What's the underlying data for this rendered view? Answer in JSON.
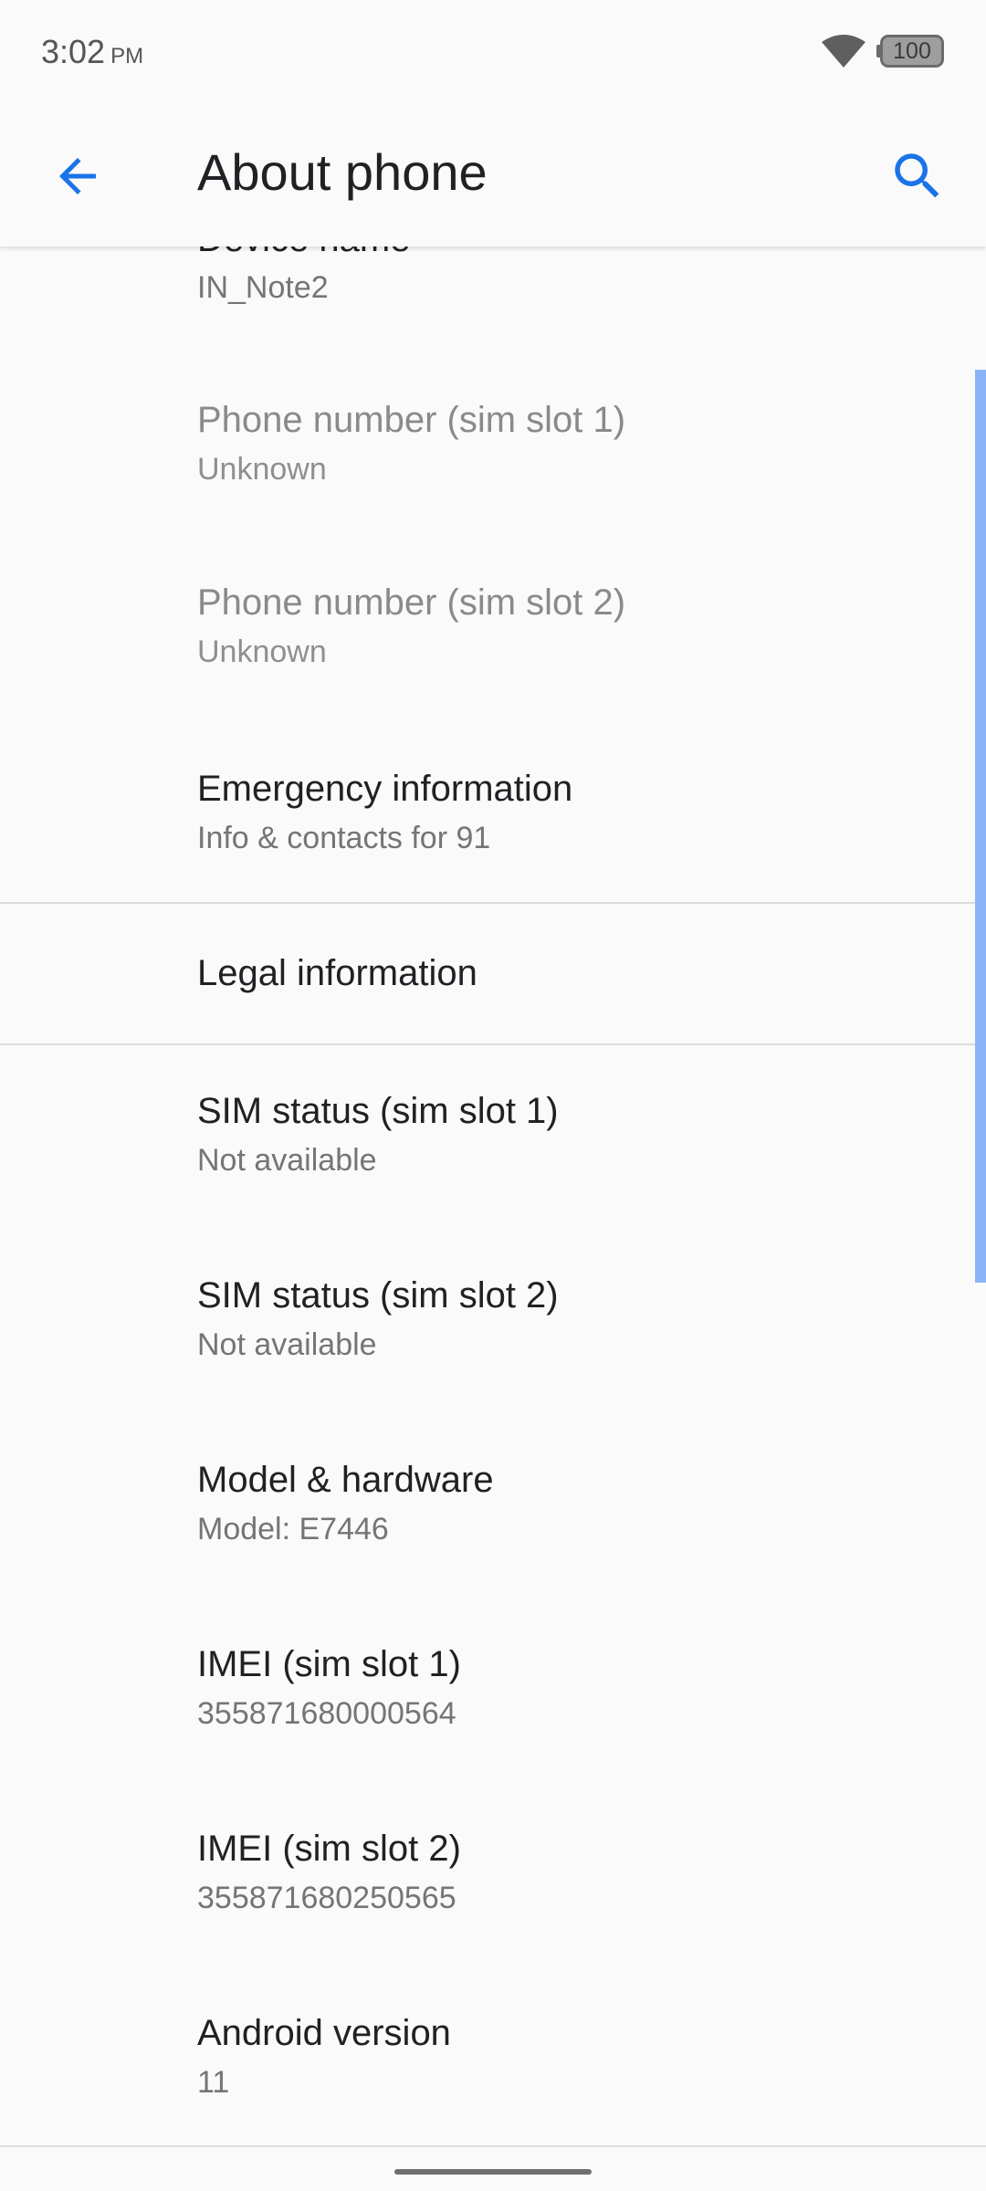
{
  "status_bar": {
    "time": "3:02",
    "ampm": "PM",
    "battery": "100",
    "wifi_icon": "wifi-icon"
  },
  "app_bar": {
    "title": "About phone",
    "back_icon": "arrow-back-icon",
    "search_icon": "search-icon",
    "accent_color": "#1a73e8"
  },
  "items": [
    {
      "title": "Device name",
      "summary": "IN_Note2"
    },
    {
      "title": "Phone number (sim slot 1)",
      "summary": "Unknown"
    },
    {
      "title": "Phone number (sim slot 2)",
      "summary": "Unknown"
    },
    {
      "title": "Emergency information",
      "summary": "Info & contacts for 91"
    },
    {
      "title": "Legal information"
    },
    {
      "title": "SIM status (sim slot 1)",
      "summary": "Not available"
    },
    {
      "title": "SIM status (sim slot 2)",
      "summary": "Not available"
    },
    {
      "title": "Model & hardware",
      "summary": "Model: E7446"
    },
    {
      "title": "IMEI (sim slot 1)",
      "summary": "355871680000564"
    },
    {
      "title": "IMEI (sim slot 2)",
      "summary": "355871680250565"
    },
    {
      "title": "Android version",
      "summary": "11"
    }
  ]
}
